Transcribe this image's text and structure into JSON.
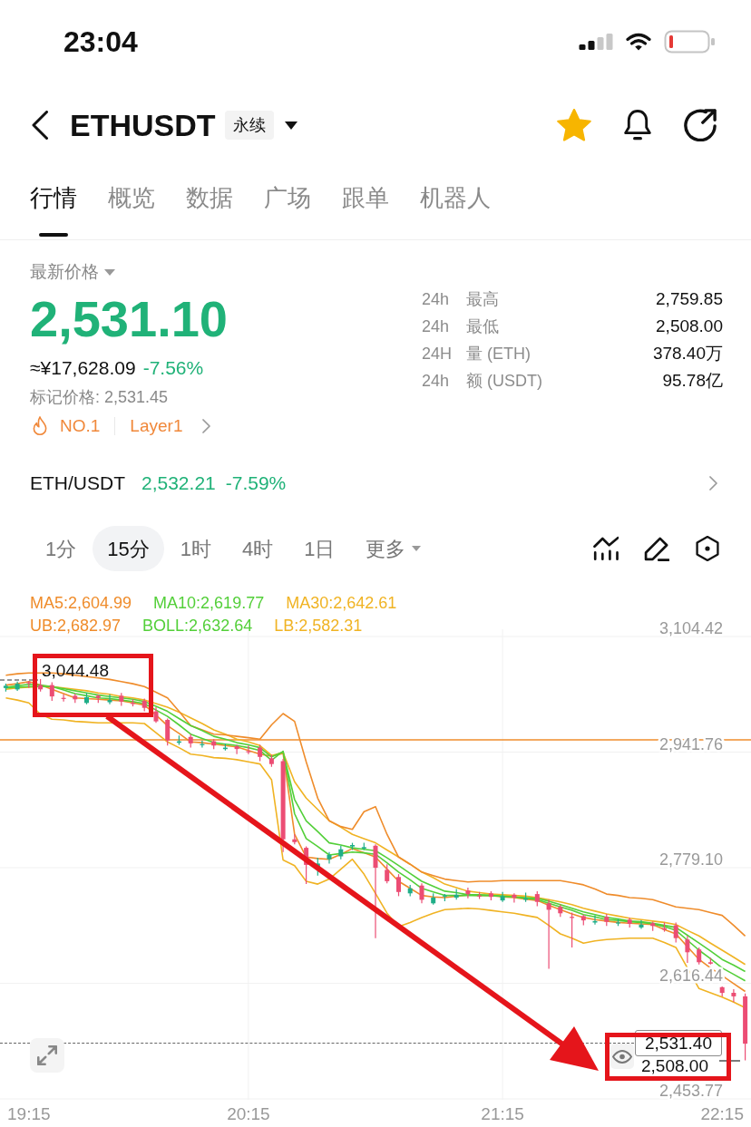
{
  "status_bar": {
    "time": "23:04"
  },
  "header": {
    "symbol": "ETHUSDT",
    "contract_badge": "永续",
    "favorite": true
  },
  "tabs": [
    {
      "label": "行情",
      "selected": true
    },
    {
      "label": "概览",
      "selected": false
    },
    {
      "label": "数据",
      "selected": false
    },
    {
      "label": "广场",
      "selected": false
    },
    {
      "label": "跟单",
      "selected": false
    },
    {
      "label": "机器人",
      "selected": false
    }
  ],
  "price_panel": {
    "label": "最新价格",
    "last_price": "2,531.10",
    "fiat_price": "≈¥17,628.09",
    "change": "-7.56%",
    "mark_price": "标记价格: 2,531.45",
    "rank": "NO.1",
    "sector": "Layer1"
  },
  "stats": [
    {
      "period": "24h",
      "label": "最高",
      "value": "2,759.85"
    },
    {
      "period": "24h",
      "label": "最低",
      "value": "2,508.00"
    },
    {
      "period": "24H",
      "label": "量 (ETH)",
      "value": "378.40万"
    },
    {
      "period": "24h",
      "label": "额 (USDT)",
      "value": "95.78亿"
    }
  ],
  "spot_pair": {
    "pair": "ETH/USDT",
    "price": "2,532.21",
    "change": "-7.59%"
  },
  "intervals": [
    {
      "label": "1分",
      "kind": "interval",
      "selected": false
    },
    {
      "label": "15分",
      "kind": "interval",
      "selected": true
    },
    {
      "label": "1时",
      "kind": "interval",
      "selected": false
    },
    {
      "label": "4时",
      "kind": "interval",
      "selected": false
    },
    {
      "label": "1日",
      "kind": "interval",
      "selected": false
    },
    {
      "label": "更多",
      "kind": "menu",
      "selected": false
    }
  ],
  "chart": {
    "high_marker": "3,044.48",
    "price_tag": "2,531.40",
    "low_marker": "2,508.00",
    "chart_data": {
      "type": "candlestick",
      "grid": true,
      "categories": [
        null,
        null,
        "19:15",
        null,
        null,
        null,
        null,
        null,
        null,
        null,
        null,
        null,
        null,
        null,
        null,
        null,
        null,
        null,
        null,
        null,
        null,
        "20:15",
        null,
        null,
        null,
        null,
        null,
        null,
        null,
        null,
        null,
        null,
        null,
        null,
        null,
        null,
        null,
        null,
        null,
        null,
        null,
        null,
        null,
        "21:15",
        null,
        null,
        null,
        null,
        null,
        null,
        null,
        null,
        null,
        null,
        null,
        null,
        null,
        null,
        null,
        null,
        null,
        null,
        "22:15",
        null,
        null
      ],
      "ohlc": [
        [
          3032,
          3038,
          3027,
          3035
        ],
        [
          3030,
          3041,
          3028,
          3038
        ],
        [
          3040,
          3042,
          3032,
          3039
        ],
        [
          3036,
          3044.48,
          3027,
          3030
        ],
        [
          3036,
          3040,
          3014,
          3020
        ],
        [
          3018,
          3023,
          3013,
          3017
        ],
        [
          3021,
          3024,
          3011,
          3016
        ],
        [
          3011,
          3025,
          3009,
          3019
        ],
        [
          3021,
          3023,
          3011,
          3018
        ],
        [
          3012,
          3023,
          3009,
          3015
        ],
        [
          3021,
          3025,
          3007,
          3013
        ],
        [
          3011,
          3016,
          3006,
          3010
        ],
        [
          3014,
          3017,
          2999,
          3004
        ],
        [
          2999,
          3005,
          2983,
          2985
        ],
        [
          2987,
          2989,
          2951,
          2958
        ],
        [
          2955,
          2965,
          2952,
          2957
        ],
        [
          2963,
          2967,
          2948,
          2954
        ],
        [
          2952,
          2958,
          2948,
          2953
        ],
        [
          2957,
          2960,
          2946,
          2951
        ],
        [
          2946,
          2954,
          2944,
          2948
        ],
        [
          2950,
          2952,
          2939,
          2946
        ],
        [
          2943,
          2951,
          2939,
          2942
        ],
        [
          2948,
          2952,
          2929,
          2935
        ],
        [
          2933,
          2938,
          2921,
          2925
        ],
        [
          2929,
          2932,
          2801,
          2819
        ],
        [
          2819,
          2826,
          2812,
          2815
        ],
        [
          2807,
          2809,
          2756,
          2783
        ],
        [
          2780,
          2793,
          2768,
          2785
        ],
        [
          2791,
          2801,
          2785,
          2797
        ],
        [
          2795,
          2810,
          2791,
          2805
        ],
        [
          2809,
          2814,
          2804,
          2811
        ],
        [
          2806,
          2814,
          2804,
          2808
        ],
        [
          2810,
          2812,
          2680,
          2779
        ],
        [
          2776,
          2784,
          2757,
          2760
        ],
        [
          2766,
          2770,
          2739,
          2745
        ],
        [
          2743,
          2755,
          2739,
          2750
        ],
        [
          2754,
          2757,
          2729,
          2734
        ],
        [
          2729,
          2743,
          2727,
          2737
        ],
        [
          2739,
          2742,
          2732,
          2740
        ],
        [
          2737,
          2749,
          2734,
          2741
        ],
        [
          2747,
          2751,
          2736,
          2742
        ],
        [
          2740,
          2745,
          2735,
          2739
        ],
        [
          2743,
          2746,
          2733,
          2738
        ],
        [
          2733,
          2745,
          2731,
          2739
        ],
        [
          2741,
          2743,
          2730,
          2737
        ],
        [
          2734,
          2744,
          2731,
          2736
        ],
        [
          2742,
          2746,
          2725,
          2731
        ],
        [
          2729,
          2734,
          2637,
          2720
        ],
        [
          2724,
          2727,
          2710,
          2715
        ],
        [
          2710,
          2716,
          2667,
          2709
        ],
        [
          2711,
          2713,
          2698,
          2705
        ],
        [
          2702,
          2712,
          2699,
          2704
        ],
        [
          2710,
          2714,
          2697,
          2703
        ],
        [
          2701,
          2707,
          2697,
          2702
        ],
        [
          2706,
          2709,
          2695,
          2700
        ],
        [
          2695,
          2705,
          2693,
          2699
        ],
        [
          2701,
          2703,
          2690,
          2697
        ],
        [
          2694,
          2702,
          2689,
          2692
        ],
        [
          2698,
          2702,
          2674,
          2680
        ],
        [
          2678,
          2683,
          2645,
          2660
        ],
        [
          2664,
          2667,
          2643,
          2646
        ],
        [
          2646,
          2652,
          2643,
          2644
        ],
        [
          2611,
          2612,
          2598,
          2603
        ],
        [
          2603,
          2608,
          2590,
          2598
        ],
        [
          2598,
          2602,
          2508,
          2531.4
        ]
      ],
      "ylim": [
        2453.77,
        3104.42
      ],
      "yticks": [
        {
          "value": 3104.42,
          "label": "3,104.42"
        },
        {
          "value": 2941.76,
          "label": "2,941.76"
        },
        {
          "value": 2779.1,
          "label": "2,779.10"
        },
        {
          "value": 2616.44,
          "label": "2,616.44"
        },
        {
          "value": 2453.77,
          "label": "2,453.77"
        }
      ],
      "ref_lines": [
        {
          "axis": "y",
          "value": 2959,
          "color": "#ef8c2b"
        }
      ],
      "series": [
        {
          "name": "MA5:2,604.99",
          "type": "line",
          "color": "#ef8c2b",
          "values": [
            3036,
            3038,
            3041,
            3036,
            3030,
            3024,
            3018,
            3017,
            3016,
            3015,
            3014,
            3011,
            3008,
            2994,
            2979,
            2968,
            2956,
            2955,
            2953,
            2951,
            2949,
            2944,
            2939,
            2936,
            2940,
            2826,
            2794,
            2792,
            2791,
            2798,
            2806,
            2800,
            2794,
            2777,
            2760,
            2750,
            2740,
            2738,
            2737,
            2739,
            2741,
            2740,
            2740,
            2738,
            2737,
            2735,
            2733,
            2726,
            2720,
            2714,
            2709,
            2706,
            2704,
            2702,
            2701,
            2700,
            2699,
            2692,
            2686,
            2668,
            2650,
            2638,
            2627,
            2616,
            2605
          ]
        },
        {
          "name": "MA10:2,619.77",
          "type": "line",
          "color": "#53cf39",
          "values": [
            3033,
            3035,
            3037,
            3036,
            3034,
            3029,
            3024,
            3021,
            3018,
            3017,
            3015,
            3013,
            3010,
            3001,
            2992,
            2980,
            2967,
            2961,
            2955,
            2953,
            2951,
            2948,
            2944,
            2930,
            2943,
            2855,
            2820,
            2809,
            2797,
            2799,
            2801,
            2800,
            2798,
            2786,
            2773,
            2762,
            2750,
            2745,
            2740,
            2740,
            2740,
            2740,
            2740,
            2739,
            2738,
            2736,
            2734,
            2729,
            2724,
            2719,
            2713,
            2710,
            2706,
            2705,
            2703,
            2702,
            2700,
            2696,
            2691,
            2677,
            2663,
            2651,
            2638,
            2629,
            2620
          ]
        },
        {
          "name": "MA30:2,642.61",
          "type": "line",
          "color": "#f0b323",
          "values": [
            3030,
            3032,
            3033,
            3034,
            3034,
            3032,
            3030,
            3028,
            3025,
            3023,
            3020,
            3018,
            3015,
            3010,
            3005,
            2998,
            2990,
            2982,
            2973,
            2967,
            2960,
            2956,
            2951,
            2937,
            2941,
            2900,
            2877,
            2861,
            2845,
            2836,
            2826,
            2820,
            2814,
            2804,
            2794,
            2784,
            2773,
            2765,
            2756,
            2751,
            2746,
            2744,
            2742,
            2741,
            2740,
            2739,
            2737,
            2734,
            2731,
            2727,
            2722,
            2718,
            2714,
            2711,
            2708,
            2706,
            2704,
            2702,
            2699,
            2691,
            2683,
            2673,
            2663,
            2653,
            2643
          ]
        },
        {
          "name": "UB:2,682.97",
          "type": "line",
          "color": "#ef8c2b",
          "values": [
            3050,
            3052,
            3053,
            3053,
            3053,
            3052,
            3050,
            3048,
            3046,
            3044,
            3041,
            3038,
            3034,
            3026,
            3018,
            2999,
            2979,
            2973,
            2967,
            2966,
            2964,
            2962,
            2960,
            2980,
            2996,
            2985,
            2928,
            2877,
            2845,
            2837,
            2833,
            2858,
            2865,
            2826,
            2794,
            2784,
            2773,
            2768,
            2763,
            2761,
            2759,
            2760,
            2760,
            2761,
            2761,
            2761,
            2761,
            2761,
            2761,
            2758,
            2755,
            2749,
            2742,
            2740,
            2737,
            2736,
            2734,
            2729,
            2724,
            2722,
            2720,
            2716,
            2712,
            2698,
            2683
          ]
        },
        {
          "name": "BOLL:2,632.64",
          "type": "line",
          "color": "#53cf39",
          "values": [
            3032,
            3033,
            3034,
            3034,
            3034,
            3031,
            3028,
            3025,
            3022,
            3020,
            3018,
            3016,
            3013,
            3006,
            2999,
            2989,
            2979,
            2972,
            2964,
            2960,
            2955,
            2952,
            2948,
            2935,
            2942,
            2875,
            2845,
            2830,
            2814,
            2811,
            2807,
            2805,
            2803,
            2793,
            2782,
            2771,
            2760,
            2753,
            2746,
            2744,
            2741,
            2741,
            2740,
            2739,
            2738,
            2737,
            2736,
            2732,
            2727,
            2722,
            2717,
            2713,
            2709,
            2707,
            2704,
            2703,
            2701,
            2698,
            2695,
            2684,
            2673,
            2662,
            2650,
            2642,
            2633
          ]
        },
        {
          "name": "LB:2,582.31",
          "type": "line",
          "color": "#f0b323",
          "values": [
            3018,
            3015,
            3011,
            2995,
            2988,
            2987,
            2985,
            2984,
            2983,
            2983,
            2983,
            2983,
            2982,
            2969,
            2956,
            2948,
            2939,
            2937,
            2934,
            2933,
            2931,
            2928,
            2925,
            2903,
            2790,
            2782,
            2760,
            2756,
            2763,
            2777,
            2791,
            2770,
            2743,
            2715,
            2696,
            2702,
            2709,
            2715,
            2720,
            2721,
            2722,
            2721,
            2719,
            2717,
            2715,
            2712,
            2709,
            2698,
            2686,
            2680,
            2673,
            2676,
            2678,
            2679,
            2680,
            2680,
            2680,
            2674,
            2667,
            2638,
            2609,
            2603,
            2597,
            2590,
            2582
          ]
        }
      ]
    }
  }
}
